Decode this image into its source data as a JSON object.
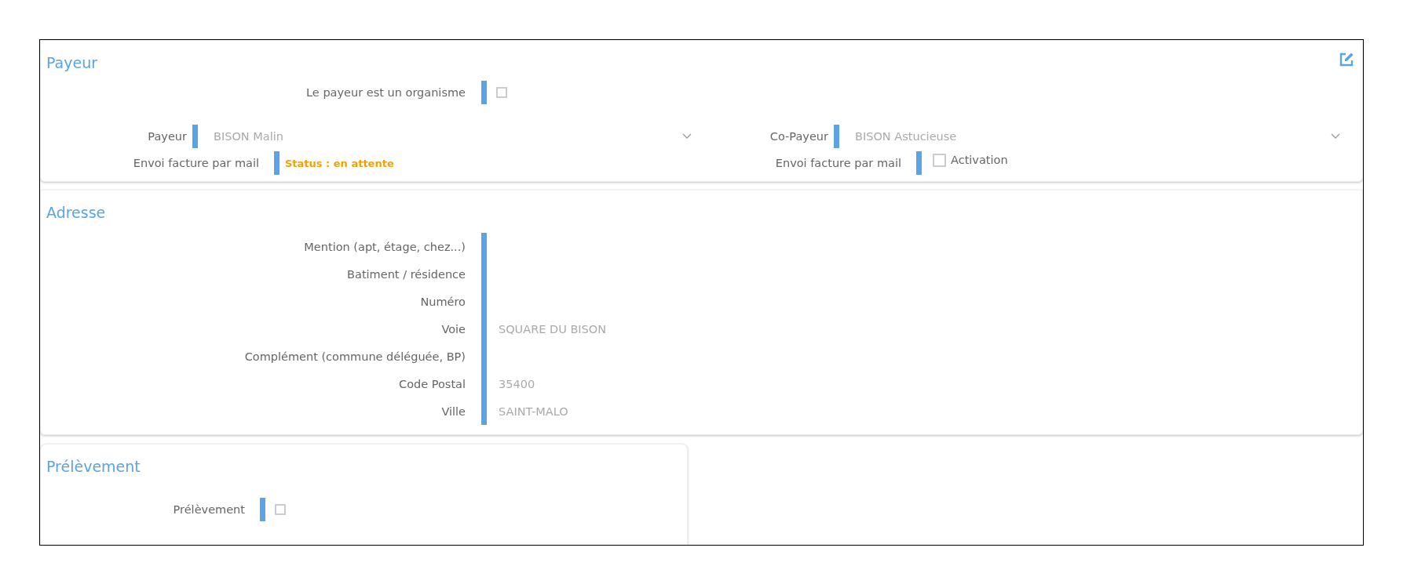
{
  "payeur": {
    "title": "Payeur",
    "organisme": {
      "label": "Le payeur est un organisme",
      "checked": false
    },
    "payeur": {
      "label": "Payeur",
      "value": "BISON Malin"
    },
    "co_payeur": {
      "label": "Co-Payeur",
      "value": "BISON Astucieuse"
    },
    "envoi_facture": {
      "label": "Envoi facture par mail",
      "status": "Status : en attente"
    },
    "envoi_facture_co": {
      "label": "Envoi facture par mail",
      "option_label": "Activation",
      "checked": false
    }
  },
  "adresse": {
    "title": "Adresse",
    "fields": [
      {
        "label": "Mention (apt, étage, chez...)"
      },
      {
        "label": "Batiment / résidence"
      },
      {
        "label": "Numéro"
      },
      {
        "label": "Voie",
        "value": "SQUARE DU BISON"
      },
      {
        "label": "Complément (commune déléguée, BP)"
      },
      {
        "label": "Code Postal",
        "value": "35400"
      },
      {
        "label": "Ville",
        "value": "SAINT-MALO"
      }
    ]
  },
  "prelevement": {
    "title": "Prélèvement",
    "field": {
      "label": "Prélèvement",
      "checked": false
    }
  }
}
